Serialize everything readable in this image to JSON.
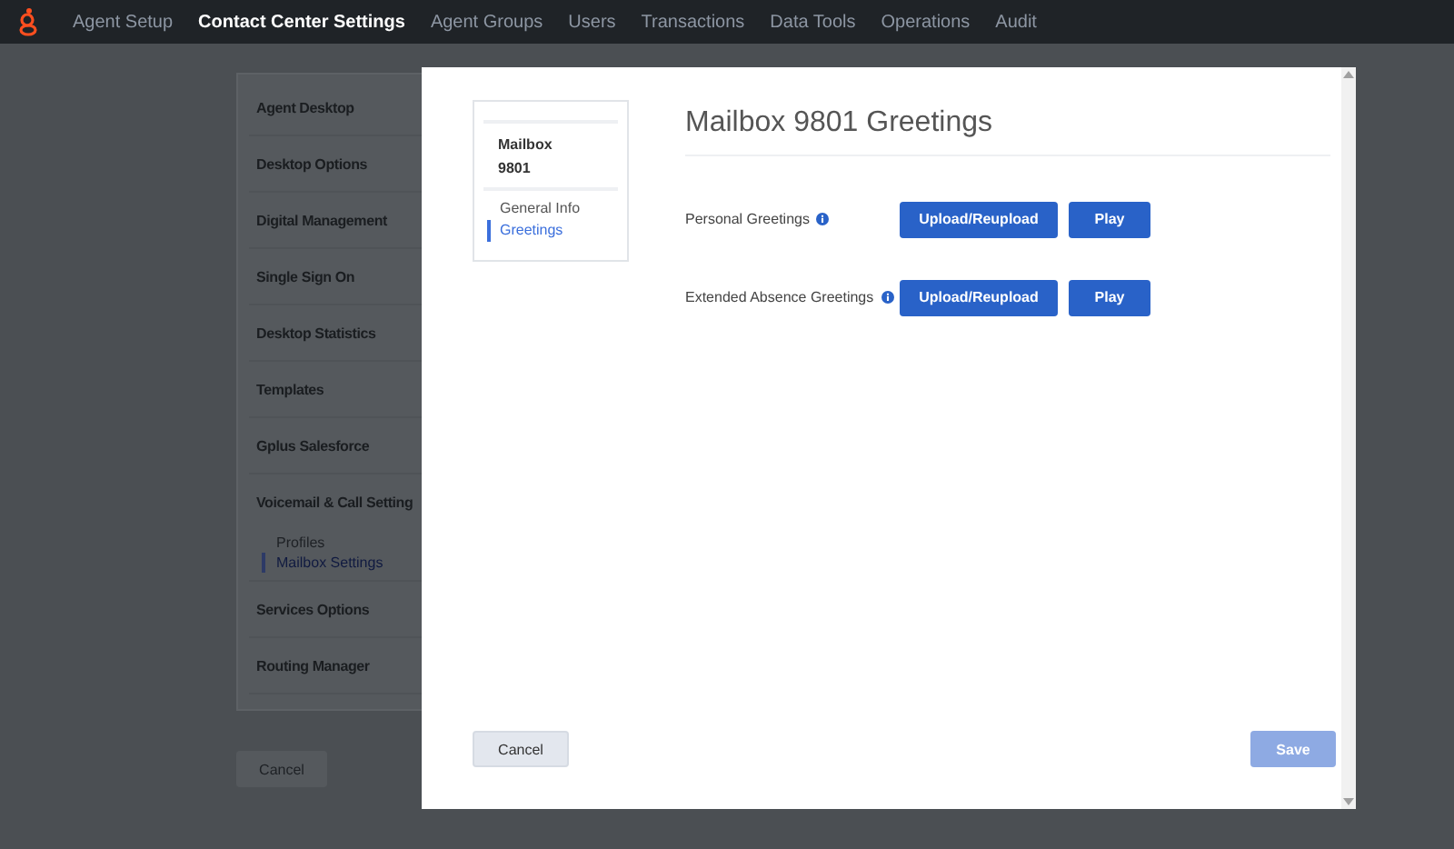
{
  "top_nav": {
    "items": [
      {
        "label": "Agent Setup",
        "selected": false
      },
      {
        "label": "Contact Center Settings",
        "selected": true
      },
      {
        "label": "Agent Groups",
        "selected": false
      },
      {
        "label": "Users",
        "selected": false
      },
      {
        "label": "Transactions",
        "selected": false
      },
      {
        "label": "Data Tools",
        "selected": false
      },
      {
        "label": "Operations",
        "selected": false
      },
      {
        "label": "Audit",
        "selected": false
      }
    ]
  },
  "settings_menu": {
    "items": [
      {
        "label": "Agent Desktop"
      },
      {
        "label": "Desktop Options"
      },
      {
        "label": "Digital Management"
      },
      {
        "label": "Single Sign On"
      },
      {
        "label": "Desktop Statistics"
      },
      {
        "label": "Templates"
      },
      {
        "label": "Gplus Salesforce"
      },
      {
        "label": "Voicemail & Call Setting",
        "children": [
          {
            "label": "Profiles",
            "selected": false
          },
          {
            "label": "Mailbox Settings",
            "selected": true
          }
        ]
      },
      {
        "label": "Services Options"
      },
      {
        "label": "Routing Manager"
      }
    ],
    "button": "Cancel"
  },
  "dialog": {
    "nav_card": {
      "title_lines": [
        "Mailbox",
        "9801"
      ],
      "items": [
        {
          "label": "General Info",
          "selected": false
        },
        {
          "label": "Greetings",
          "selected": true
        }
      ]
    },
    "title": "Mailbox 9801 Greetings",
    "rows": [
      {
        "label": "Personal Greetings",
        "buttons": [
          "Upload/Reupload",
          "Play"
        ]
      },
      {
        "label": "Extended Absence Greetings",
        "buttons": [
          "Upload/Reupload",
          "Play"
        ]
      }
    ],
    "cancel": "Cancel",
    "save": {
      "label": "Save",
      "disabled": true
    }
  }
}
